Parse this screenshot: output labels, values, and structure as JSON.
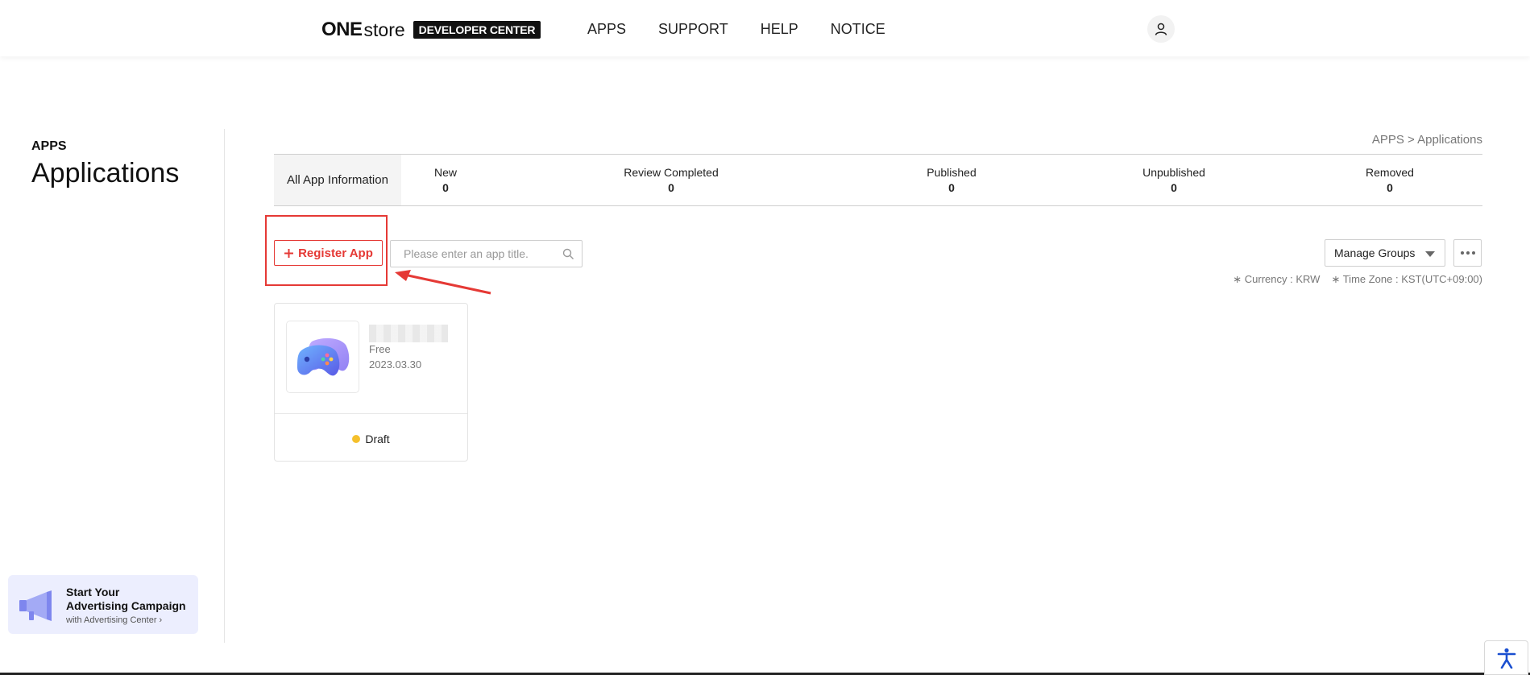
{
  "header": {
    "logo_one": "ONE",
    "logo_store": "store",
    "logo_badge": "DEVELOPER CENTER",
    "nav": [
      "APPS",
      "SUPPORT",
      "HELP",
      "NOTICE"
    ]
  },
  "sidebar": {
    "section": "APPS",
    "title": "Applications",
    "ad": {
      "line1": "Start Your",
      "line2": "Advertising Campaign",
      "line3": "with Advertising Center ›"
    }
  },
  "breadcrumb": "APPS > Applications",
  "status_tabs": {
    "all_label": "All App Information",
    "items": [
      {
        "label": "New",
        "count": "0"
      },
      {
        "label": "Review Completed",
        "count": "0"
      },
      {
        "label": "Published",
        "count": "0"
      },
      {
        "label": "Unpublished",
        "count": "0"
      },
      {
        "label": "Removed",
        "count": "0"
      }
    ]
  },
  "toolbar": {
    "register_label": "Register App",
    "search_placeholder": "Please enter an app title.",
    "manage_groups": "Manage Groups",
    "currency": "∗ Currency : KRW",
    "timezone": "∗ Time Zone : KST(UTC+09:00)"
  },
  "apps": [
    {
      "price": "Free",
      "date": "2023.03.30",
      "status": "Draft"
    }
  ],
  "colors": {
    "accent": "#e53935",
    "draft_dot": "#f5c02c"
  }
}
